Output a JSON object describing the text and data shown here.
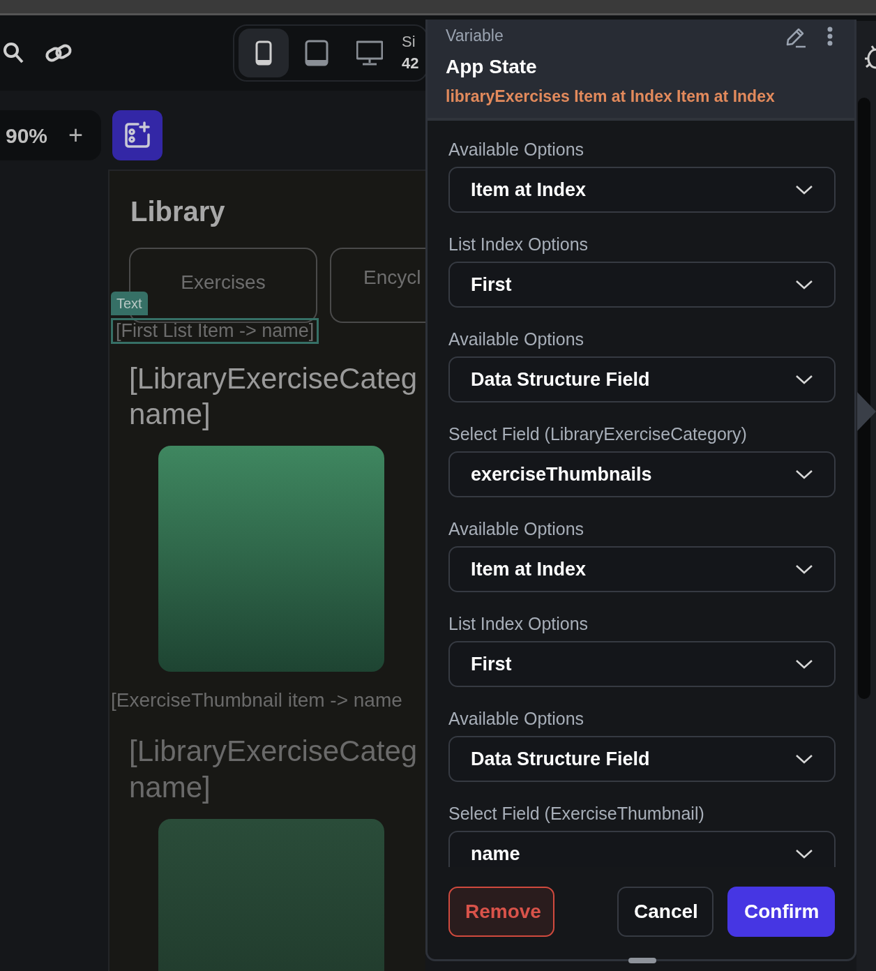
{
  "toolbar": {
    "devices": [
      {
        "kind": "phone",
        "selected": true
      },
      {
        "kind": "tablet",
        "selected": false
      },
      {
        "kind": "desktop",
        "selected": false
      }
    ],
    "size_label": "Si",
    "size_value": "42"
  },
  "zoom": {
    "value": "90%",
    "plus": "+"
  },
  "canvas": {
    "title": "Library",
    "tabs": [
      "Exercises",
      "Encycl"
    ],
    "selection_tag": "Text",
    "selected_text": "[First List Item -> name]",
    "sections": [
      {
        "heading_lines": [
          "[LibraryExerciseCateg",
          "name]"
        ],
        "caption": "[ExerciseThumbnail item -> name"
      },
      {
        "heading_lines": [
          "[LibraryExerciseCateg",
          "name]"
        ]
      }
    ]
  },
  "panel": {
    "kind_label": "Variable",
    "title": "App State",
    "path": "libraryExercises Item at Index Item at Index",
    "fields": [
      {
        "label": "Available Options",
        "value": "Item at Index"
      },
      {
        "label": "List Index Options",
        "value": "First"
      },
      {
        "label": "Available Options",
        "value": "Data Structure Field"
      },
      {
        "label": "Select Field (LibraryExerciseCategory)",
        "value": "exerciseThumbnails"
      },
      {
        "label": "Available Options",
        "value": "Item at Index"
      },
      {
        "label": "List Index Options",
        "value": "First"
      },
      {
        "label": "Available Options",
        "value": "Data Structure Field"
      },
      {
        "label": "Select Field (ExerciseThumbnail)",
        "value": "name"
      }
    ],
    "buttons": [
      {
        "kind": "danger",
        "label": "Remove"
      },
      {
        "kind": "secondary",
        "label": "Cancel"
      },
      {
        "kind": "primary",
        "label": "Confirm"
      }
    ]
  }
}
